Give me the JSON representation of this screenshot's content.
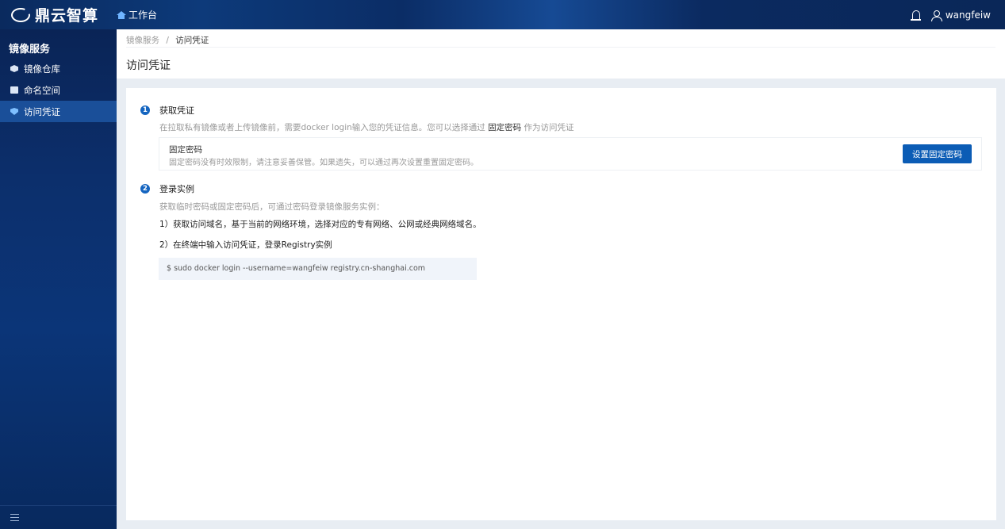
{
  "app": {
    "name": "鼎云智算"
  },
  "topbar": {
    "workbench_label": "工作台",
    "username": "wangfeiw"
  },
  "sidebar": {
    "title": "镜像服务",
    "items": [
      {
        "label": "镜像仓库",
        "icon": "cube-icon",
        "active": false
      },
      {
        "label": "命名空间",
        "icon": "namespace-icon",
        "active": false
      },
      {
        "label": "访问凭证",
        "icon": "shield-icon",
        "active": true
      }
    ]
  },
  "breadcrumb": {
    "parent": "镜像服务",
    "separator": "/",
    "current": "访问凭证"
  },
  "page": {
    "title": "访问凭证"
  },
  "steps": [
    {
      "num": "1",
      "title": "获取凭证",
      "desc_prefix": "在拉取私有镜像或者上传镜像前，需要docker login输入您的凭证信息。您可以选择通过",
      "desc_highlight": "固定密码",
      "desc_suffix": "作为访问凭证"
    },
    {
      "num": "2",
      "title": "登录实例",
      "desc": "获取临时密码或固定密码后，可通过密码登录镜像服务实例：",
      "line1": "1）获取访问域名，基于当前的网络环境，选择对应的专有网络、公网或经典网络域名。",
      "line2": "2）在终端中输入访问凭证，登录Registry实例",
      "code": "$ sudo docker login --username=wangfeiw registry.cn-shanghai.com"
    }
  ],
  "fixed_password": {
    "title": "固定密码",
    "desc": "固定密码没有时效限制，请注意妥善保管。如果遗失，可以通过再次设置重置固定密码。",
    "button_label": "设置固定密码"
  },
  "colors": {
    "primary": "#0b5cb5",
    "sidebar_active": "#1a4f99",
    "topbar": "#0b2d66"
  }
}
